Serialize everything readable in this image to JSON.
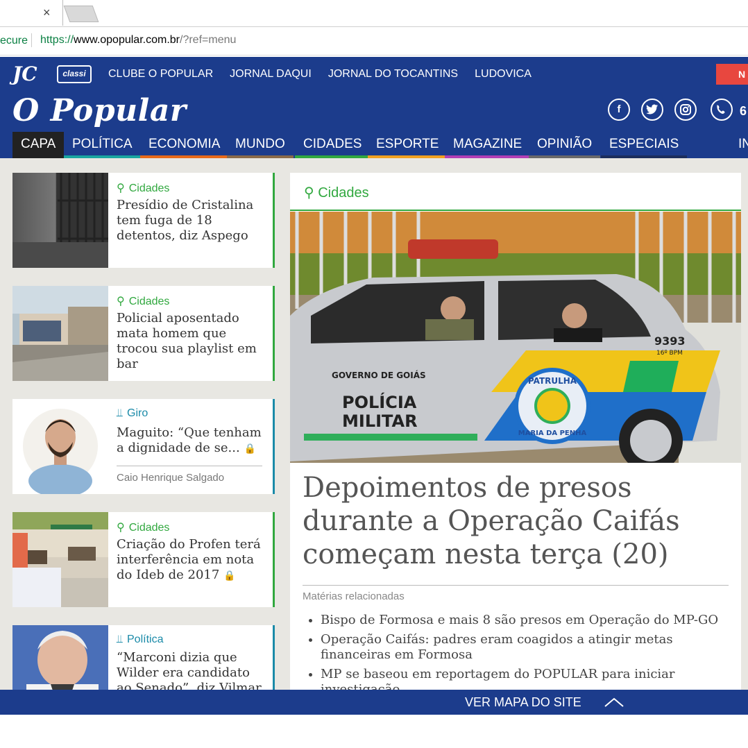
{
  "browser": {
    "tab_close": "×",
    "url_secure": "ecure",
    "url_proto": "https://",
    "url_domain": "www.opopular.com.br",
    "url_path": "/?ref=menu"
  },
  "topbar": {
    "logo_jc": "JC",
    "logo_classi": "classi",
    "links": [
      "CLUBE O POPULAR",
      "JORNAL DAQUI",
      "JORNAL DO TOCANTINS",
      "LUDOVICA"
    ],
    "red_button": "N"
  },
  "masthead": {
    "brand": "O Popular",
    "social": [
      "facebook-icon",
      "twitter-icon",
      "instagram-icon",
      "whatsapp-icon"
    ],
    "phone_partial": "6"
  },
  "nav": {
    "items": [
      {
        "label": "CAPA",
        "color": "#222222"
      },
      {
        "label": "POLÍTICA",
        "color": "#1aa6a0"
      },
      {
        "label": "ECONOMIA",
        "color": "#e86a1a"
      },
      {
        "label": "MUNDO",
        "color": "#8a6b4a"
      },
      {
        "label": "CIDADES",
        "color": "#31a83f"
      },
      {
        "label": "ESPORTE",
        "color": "#f0a020"
      },
      {
        "label": "MAGAZINE",
        "color": "#b23fb5"
      },
      {
        "label": "OPINIÃO",
        "color": "#6a6a6a"
      },
      {
        "label": "ESPECIAIS",
        "color": "#1c2e5c"
      },
      {
        "label": "IN",
        "color": "#1c3c8c"
      }
    ]
  },
  "sidebar": {
    "cards": [
      {
        "category": "Cidades",
        "headline": "Presídio de Cristalina tem fuga de 18 detentos, diz Aspego"
      },
      {
        "category": "Cidades",
        "headline": "Policial aposentado mata homem que trocou sua playlist em bar"
      },
      {
        "category": "Giro",
        "headline": "Maguito: “Que tenham a dignidade de se...",
        "author": "Caio Henrique Salgado"
      },
      {
        "category": "Cidades",
        "headline": "Criação do Profen terá interferência em nota do Ideb de 2017"
      },
      {
        "category": "Política",
        "headline": "“Marconi dizia que Wilder era candidato ao Senado”, diz Vilmar"
      }
    ]
  },
  "main": {
    "category": "Cidades",
    "photo": {
      "plate": "9393",
      "plate_sub": "16º BPM",
      "door_top": "GOVERNO DE GOIÁS",
      "door_line1": "POLÍCIA",
      "door_line2": "MILITAR",
      "badge_top": "PATRULHA",
      "badge_bottom": "MARIA DA PENHA"
    },
    "title": "Depoimentos de presos durante a Operação Caifás começam nesta terça (20)",
    "related_label": "Matérias relacionadas",
    "related": [
      "Bispo de Formosa e mais 8 são presos em Operação do MP-GO",
      "Operação Caifás: padres eram coagidos a atingir metas financeiras em Formosa",
      "MP se baseou em reportagem do POPULAR para iniciar investigação"
    ]
  },
  "footer": {
    "sitemap": "VER MAPA DO SITE"
  }
}
